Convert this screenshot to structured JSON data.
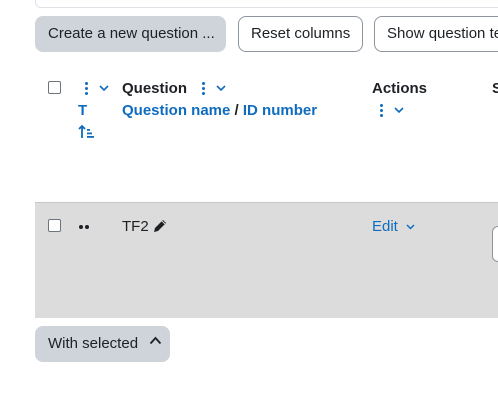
{
  "toolbar": {
    "create_label": "Create a new question ...",
    "reset_label": "Reset columns",
    "show_label": "Show question te"
  },
  "table": {
    "headers": {
      "question": "Question",
      "sort_initial": "T",
      "question_name": "Question name",
      "separator": "/",
      "id_number": "ID number",
      "actions": "Actions",
      "clipped": "S"
    },
    "rows": [
      {
        "name": "TF2",
        "action_label": "Edit"
      }
    ]
  },
  "footer": {
    "with_selected_label": "With selected"
  },
  "colors": {
    "accent": "#0f6cbf",
    "button_grey": "#ced4da",
    "selected_row": "#dcdcdc"
  },
  "icons": [
    "kebab-menu-icon",
    "chevron-down-icon",
    "sort-ascending-icon",
    "drag-handle-icon",
    "pencil-icon",
    "chevron-up-icon"
  ]
}
